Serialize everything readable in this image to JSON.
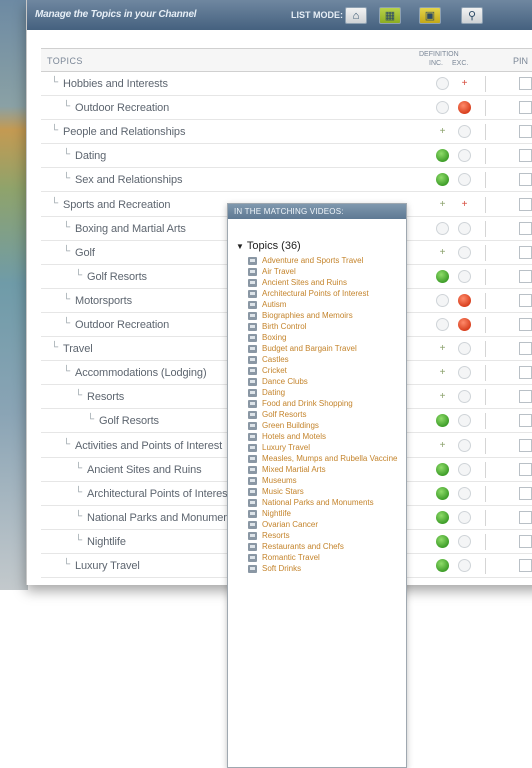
{
  "toolbar": {
    "title": "Manage the Topics in your Channel",
    "list_mode_label": "LIST MODE:"
  },
  "table": {
    "col_topics": "TOPICS",
    "col_definition": "DEFINITION",
    "col_inc": "INC.",
    "col_exc": "EXC.",
    "col_pin": "PIN",
    "rows": [
      {
        "label": "Hobbies and Interests",
        "inc": "grey",
        "exc": "plus-red"
      },
      {
        "label": "Outdoor Recreation",
        "inc": "grey",
        "exc": "red"
      },
      {
        "label": "People and Relationships",
        "inc": "plus-grey",
        "exc": "grey"
      },
      {
        "label": "Dating",
        "inc": "green",
        "exc": "grey"
      },
      {
        "label": "Sex and Relationships",
        "inc": "green",
        "exc": "grey"
      },
      {
        "label": "Sports and Recreation",
        "inc": "plus-grey",
        "exc": "plus-red"
      },
      {
        "label": "Boxing and Martial Arts",
        "inc": "grey",
        "exc": "grey"
      },
      {
        "label": "Golf",
        "inc": "plus-grey",
        "exc": "grey"
      },
      {
        "label": "Golf Resorts",
        "inc": "green",
        "exc": "grey"
      },
      {
        "label": "Motorsports",
        "inc": "grey",
        "exc": "red"
      },
      {
        "label": "Outdoor Recreation",
        "inc": "grey",
        "exc": "red"
      },
      {
        "label": "Travel",
        "inc": "plus-grey",
        "exc": "grey"
      },
      {
        "label": "Accommodations (Lodging)",
        "inc": "plus-grey",
        "exc": "grey"
      },
      {
        "label": "Resorts",
        "inc": "plus-grey",
        "exc": "grey"
      },
      {
        "label": "Golf Resorts",
        "inc": "green",
        "exc": "grey"
      },
      {
        "label": "Activities and Points of Interest",
        "inc": "plus-grey",
        "exc": "grey"
      },
      {
        "label": "Ancient Sites and Ruins",
        "inc": "green",
        "exc": "grey"
      },
      {
        "label": "Architectural Points of Interest",
        "inc": "green",
        "exc": "grey"
      },
      {
        "label": "National Parks and Monuments",
        "inc": "green",
        "exc": "grey"
      },
      {
        "label": "Nightlife",
        "inc": "green",
        "exc": "grey"
      },
      {
        "label": "Luxury Travel",
        "inc": "green",
        "exc": "grey"
      }
    ]
  },
  "popup": {
    "header": "IN THE MATCHING VIDEOS:",
    "title": "Topics (36)",
    "items": [
      "Adventure and Sports Travel",
      "Air Travel",
      "Ancient Sites and Ruins",
      "Architectural Points of Interest",
      "Autism",
      "Biographies and Memoirs",
      "Birth Control",
      "Boxing",
      "Budget and Bargain Travel",
      "Castles",
      "Cricket",
      "Dance Clubs",
      "Dating",
      "Food and Drink Shopping",
      "Golf Resorts",
      "Green Buildings",
      "Hotels and Motels",
      "Luxury Travel",
      "Measles, Mumps and Rubella Vaccine",
      "Mixed Martial Arts",
      "Museums",
      "Music Stars",
      "National Parks and Monuments",
      "Nightlife",
      "Ovarian Cancer",
      "Resorts",
      "Restaurants and Chefs",
      "Romantic Travel",
      "Soft Drinks"
    ]
  }
}
